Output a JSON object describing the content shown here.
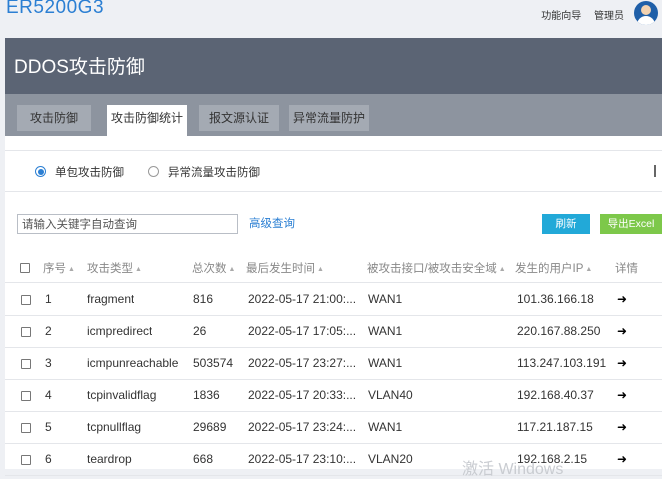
{
  "brand": "ER5200G3",
  "top_links": {
    "wizard": "功能向导",
    "admin": "管理员"
  },
  "page_title": "DDOS攻击防御",
  "tabs": [
    "攻击防御",
    "攻击防御统计",
    "报文源认证",
    "异常流量防护"
  ],
  "active_tab": "攻击防御统计",
  "radios": {
    "single_packet": "单包攻击防御",
    "abnormal_traffic": "异常流量攻击防御",
    "selected": "单包攻击防御"
  },
  "search": {
    "placeholder": "请输入关键字自动查询",
    "advanced": "高级查询"
  },
  "buttons": {
    "refresh": "刷新",
    "export": "导出Excel"
  },
  "table": {
    "headers": [
      "序号",
      "攻击类型",
      "总次数",
      "最后发生时间",
      "被攻击接口/被攻击安全域",
      "发生的用户IP",
      "详情"
    ],
    "rows": [
      {
        "no": "1",
        "type": "fragment",
        "count": "816",
        "time": "2022-05-17 21:00:...",
        "iface": "WAN1",
        "ip": "101.36.166.18",
        "detail": "➜"
      },
      {
        "no": "2",
        "type": "icmpredirect",
        "count": "26",
        "time": "2022-05-17 17:05:...",
        "iface": "WAN1",
        "ip": "220.167.88.250",
        "detail": "➜"
      },
      {
        "no": "3",
        "type": "icmpunreachable",
        "count": "503574",
        "time": "2022-05-17 23:27:...",
        "iface": "WAN1",
        "ip": "113.247.103.191",
        "detail": "➜"
      },
      {
        "no": "4",
        "type": "tcpinvalidflag",
        "count": "1836",
        "time": "2022-05-17 20:33:...",
        "iface": "VLAN40",
        "ip": "192.168.40.37",
        "detail": "➜"
      },
      {
        "no": "5",
        "type": "tcpnullflag",
        "count": "29689",
        "time": "2022-05-17 23:24:...",
        "iface": "WAN1",
        "ip": "117.21.187.15",
        "detail": "➜"
      },
      {
        "no": "6",
        "type": "teardrop",
        "count": "668",
        "time": "2022-05-17 23:10:...",
        "iface": "VLAN20",
        "ip": "192.168.2.15",
        "detail": "➜"
      }
    ]
  },
  "watermark": "激活 Windows",
  "colors": {
    "brand": "#2b7fd3",
    "header": "#5b6474",
    "tabbar": "#8d949f",
    "refresh": "#22a9d8",
    "export": "#7dc84a"
  }
}
